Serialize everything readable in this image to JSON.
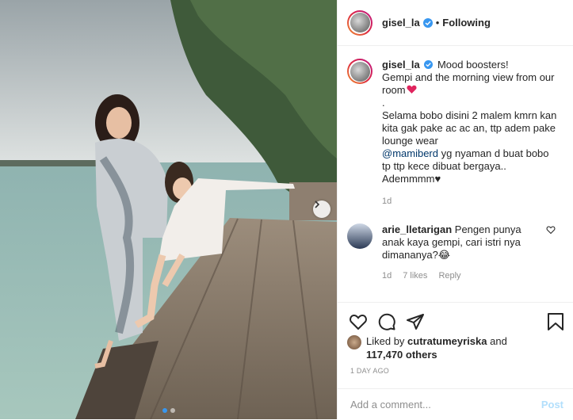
{
  "header": {
    "username": "gisel_la",
    "separator": "•",
    "follow_status": "Following"
  },
  "caption": {
    "username": "gisel_la",
    "line1": "Mood boosters!",
    "line2": "Gempi and the morning view from our room",
    "line3": ".",
    "line4": "Selama bobo disini 2 malem kmrn kan kita gak pake ac ac an, ttp adem pake lounge wear",
    "mention": "@mamiberd",
    "line5": "yg nyaman d buat bobo tp ttp kece dibuat bergaya.. Ademmmm♥",
    "age": "1d"
  },
  "comment": {
    "username": "arie_lletarigan",
    "text": "Pengen punya anak kaya gempi, cari istri nya dimananya?😂",
    "age": "1d",
    "likes": "7 likes",
    "reply": "Reply"
  },
  "likes": {
    "prefix": "Liked by",
    "user": "cutratumeyriska",
    "and": "and",
    "others": "117,470 others"
  },
  "date": "1 DAY AGO",
  "add_comment": {
    "placeholder": "Add a comment...",
    "post_label": "Post"
  },
  "carousel": {
    "dot_count": 2,
    "active_index": 0
  },
  "icons": [
    "verified-badge-icon",
    "heart-icon",
    "comment-icon",
    "share-icon",
    "bookmark-icon",
    "chevron-right-icon"
  ],
  "colors": {
    "verified": "#3897f0",
    "link": "#00376b",
    "meta": "#8e8e8e",
    "post_button": "#b2dffc"
  }
}
